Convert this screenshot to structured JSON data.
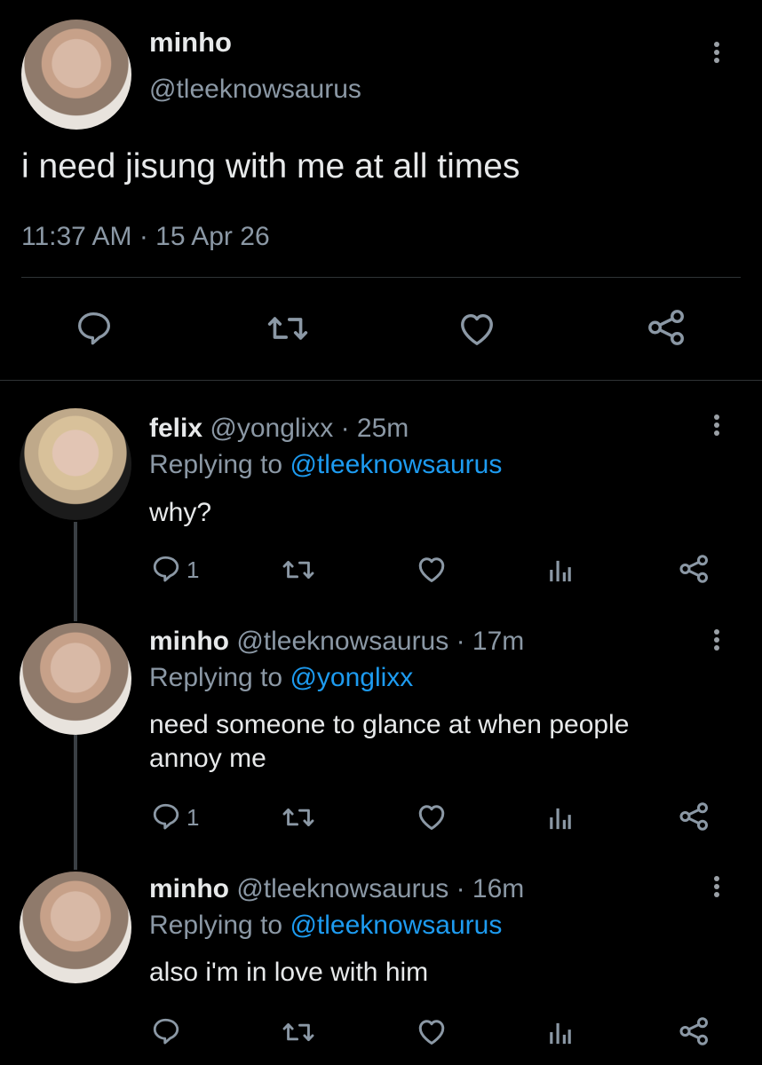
{
  "main_tweet": {
    "name": "minho",
    "handle": "@tleeknowsaurus",
    "text": "i need jisung with me at all times",
    "timestamp": "11:37 AM · 15 Apr 26"
  },
  "replies": [
    {
      "name": "felix",
      "handle": "@yonglixx",
      "time": "· 25m",
      "replying_label": "Replying to",
      "replying_to": "@tleeknowsaurus",
      "text_lines": [
        "why?"
      ],
      "reply_count": "1"
    },
    {
      "name": "minho",
      "handle": "@tleeknowsaurus",
      "time": "· 17m",
      "replying_label": "Replying to",
      "replying_to": "@yonglixx",
      "text_lines": [
        "need someone to glance at when people",
        "annoy me"
      ],
      "reply_count": "1"
    },
    {
      "name": "minho",
      "handle": "@tleeknowsaurus",
      "time": "· 16m",
      "replying_label": "Replying to",
      "replying_to": "@tleeknowsaurus",
      "text_lines": [
        "also i'm in love with him"
      ],
      "reply_count": ""
    }
  ],
  "icons": {
    "reply": "reply-icon",
    "retweet": "retweet-icon",
    "like": "heart-icon",
    "analytics": "analytics-icon",
    "share": "share-icon",
    "more": "more-icon"
  },
  "colors": {
    "background": "#000000",
    "text": "#e7e9ea",
    "secondary": "#8b98a5",
    "link": "#1d9bf0"
  }
}
